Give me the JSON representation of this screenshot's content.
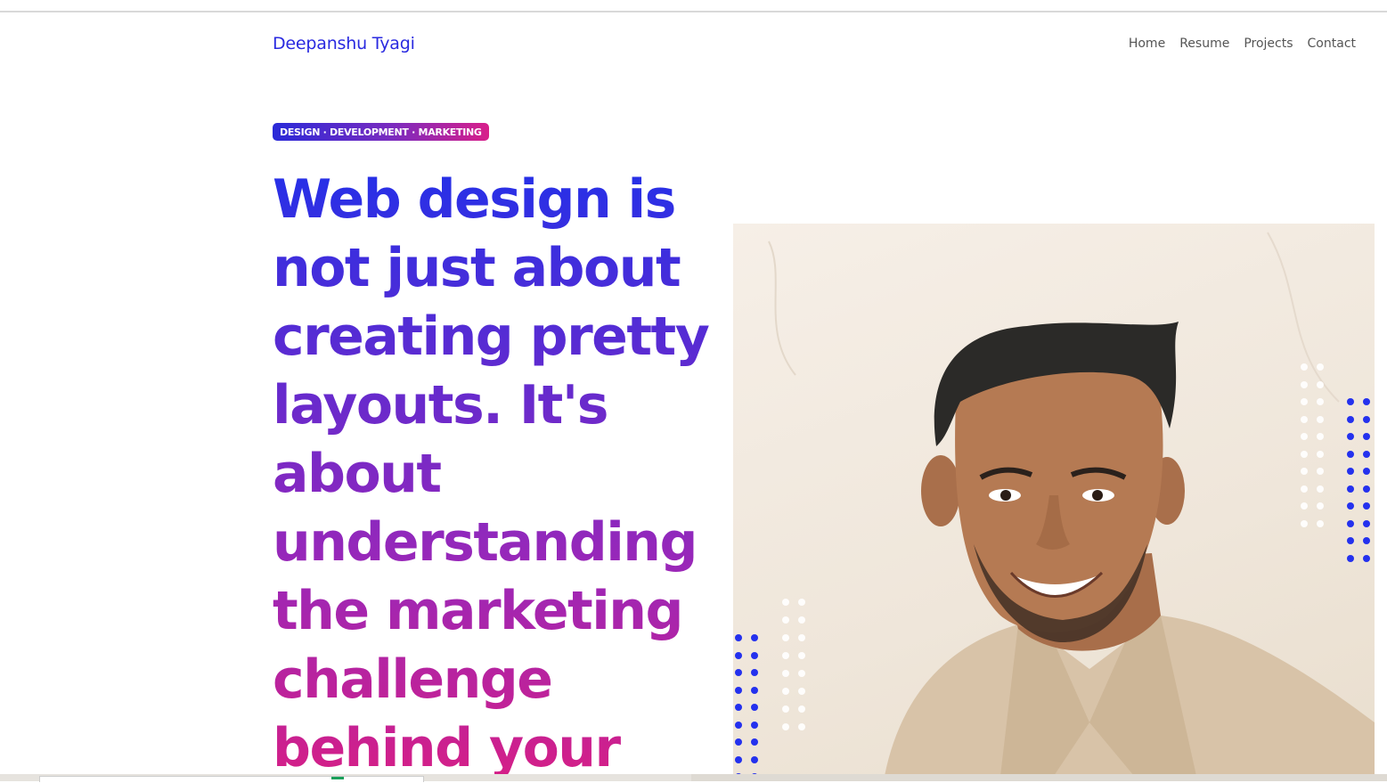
{
  "header": {
    "brand": "Deepanshu Tyagi",
    "nav": [
      "Home",
      "Resume",
      "Projects",
      "Contact"
    ]
  },
  "hero": {
    "badge": "DESIGN · DEVELOPMENT · MARKETING",
    "headline": "Web design is not just about creating pretty layouts. It's about understanding the marketing challenge behind your"
  },
  "colors": {
    "accent_blue": "#2a2ae0",
    "gradient_start": "#2430e8",
    "gradient_end": "#d61f86"
  },
  "icons": [
    "portrait-photo",
    "dot-pattern"
  ]
}
